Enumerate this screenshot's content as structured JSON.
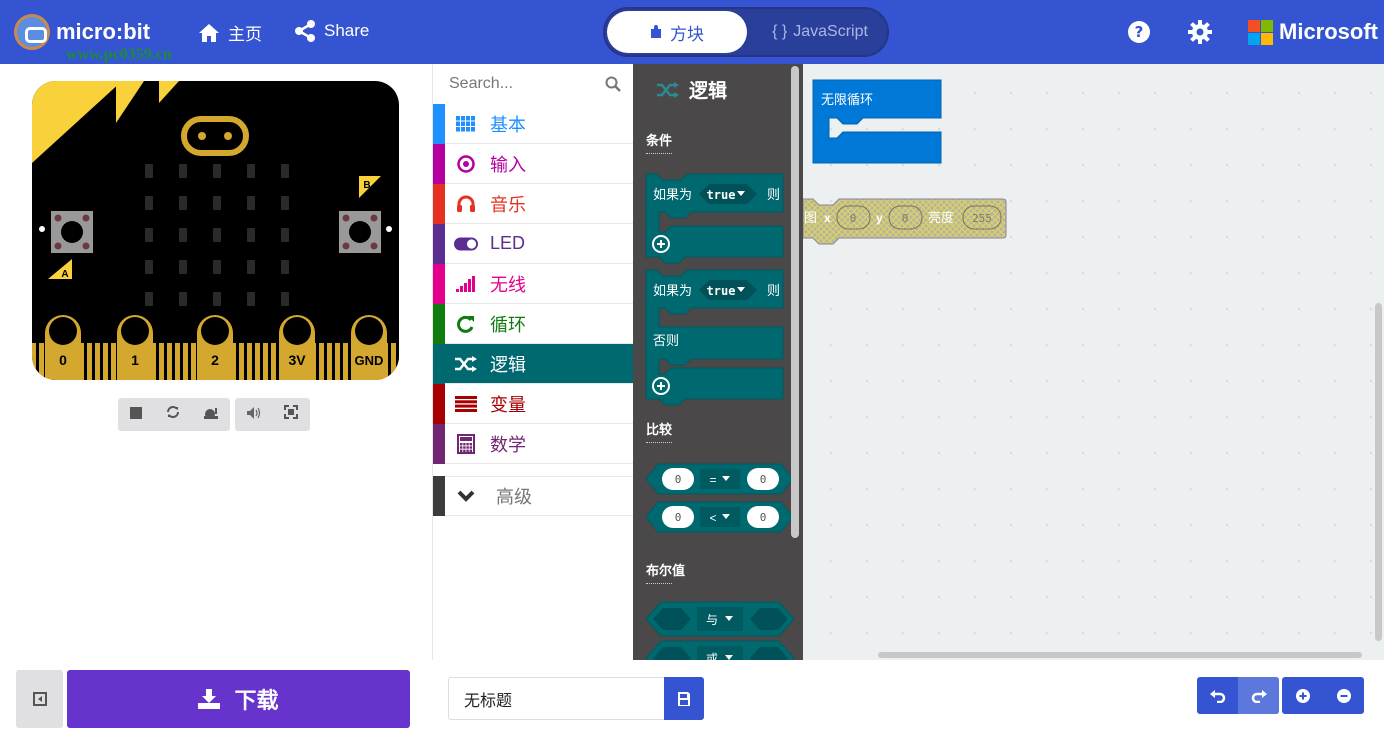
{
  "header": {
    "logo_text": "micro:bit",
    "watermark_text": "www.pc0359.cn",
    "home_label": "主页",
    "share_label": "Share",
    "mode_blocks_label": "方块",
    "mode_js_label": "JavaScript",
    "mode_js_prefix": "{ }",
    "brand_label": "Microsoft",
    "accent_color": "#3454D1"
  },
  "simulator": {
    "button_a_label": "A",
    "button_b_label": "B",
    "pins": [
      "0",
      "1",
      "2",
      "3V",
      "GND"
    ],
    "toolbar": [
      "stop",
      "restart",
      "slow-motion",
      "mute",
      "fullscreen"
    ]
  },
  "toolbox": {
    "search_placeholder": "Search...",
    "categories": [
      {
        "label": "基本",
        "color": "#1E90FF",
        "icon": "grid-icon"
      },
      {
        "label": "输入",
        "color": "#B4009E",
        "icon": "target-icon"
      },
      {
        "label": "音乐",
        "color": "#E63022",
        "icon": "headphones-icon"
      },
      {
        "label": "LED",
        "color": "#5C2D91",
        "icon": "toggle-icon"
      },
      {
        "label": "无线",
        "color": "#E3008C",
        "icon": "signal-icon"
      },
      {
        "label": "循环",
        "color": "#107C10",
        "icon": "refresh-icon"
      },
      {
        "label": "逻辑",
        "color": "#006970",
        "icon": "shuffle-icon",
        "selected": true
      },
      {
        "label": "变量",
        "color": "#A80000",
        "icon": "list-icon"
      },
      {
        "label": "数学",
        "color": "#712672",
        "icon": "calculator-icon"
      }
    ],
    "advanced_label": "高级"
  },
  "flyout": {
    "title": "逻辑",
    "sections": {
      "conditions": "条件",
      "comparison": "比较",
      "boolean": "布尔值"
    },
    "if_label": "如果为",
    "then_label": "则",
    "else_label": "否则",
    "bool_value": "true",
    "compare_left": "0",
    "compare_right": "0",
    "compare_op_eq": "=",
    "compare_op_lt": "<",
    "and_label": "与",
    "or_label": "或"
  },
  "workspace": {
    "forever_label": "无限循环",
    "plot_block": {
      "label": "图",
      "x_label": "x",
      "x_value": "0",
      "y_label": "y",
      "y_value": "0",
      "brightness_label": "亮度",
      "brightness_value": "255"
    }
  },
  "footer": {
    "download_label": "下载",
    "project_name": "无标题"
  }
}
